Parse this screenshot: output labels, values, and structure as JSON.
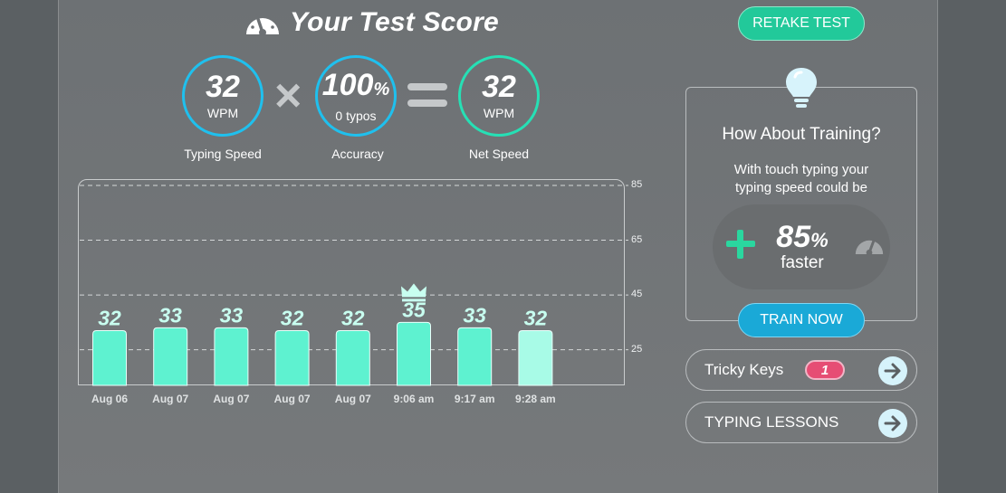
{
  "header": {
    "title": "Your Test Score",
    "retake_label": "RETAKE TEST"
  },
  "score": {
    "speed": {
      "value": "32",
      "unit": "WPM",
      "label": "Typing Speed"
    },
    "accuracy": {
      "value": "100",
      "suffix": "%",
      "unit": "0 typos",
      "label": "Accuracy"
    },
    "net": {
      "value": "32",
      "unit": "WPM",
      "label": "Net Speed"
    }
  },
  "chart_data": {
    "type": "bar",
    "categories": [
      "Aug 06",
      "Aug 07",
      "Aug 07",
      "Aug 07",
      "Aug 07",
      "9:06 am",
      "9:17 am",
      "9:28 am"
    ],
    "values": [
      32,
      33,
      33,
      32,
      32,
      35,
      33,
      32
    ],
    "data_labels": [
      "32",
      "33",
      "33",
      "32",
      "32",
      "35",
      "33",
      "32"
    ],
    "y_ticks": [
      "85",
      "65",
      "45",
      "25"
    ],
    "ylim": [
      12,
      85
    ],
    "best_index": 5,
    "bar_color": "#5ef2d0",
    "latest_bar_color": "#a8fbe7",
    "grid": true
  },
  "training": {
    "title": "How About Training?",
    "desc_line1": "With touch typing your",
    "desc_line2": "typing speed could be",
    "pct": "85",
    "pct_suffix": "%",
    "faster": "faster",
    "button": "TRAIN NOW"
  },
  "links": {
    "tricky_keys": "Tricky Keys",
    "tricky_count": "1",
    "lessons": "TYPING LESSONS"
  },
  "colors": {
    "accent_green": "#22c99a",
    "accent_blue": "#1fc0ee",
    "badge": "#e64d74"
  }
}
